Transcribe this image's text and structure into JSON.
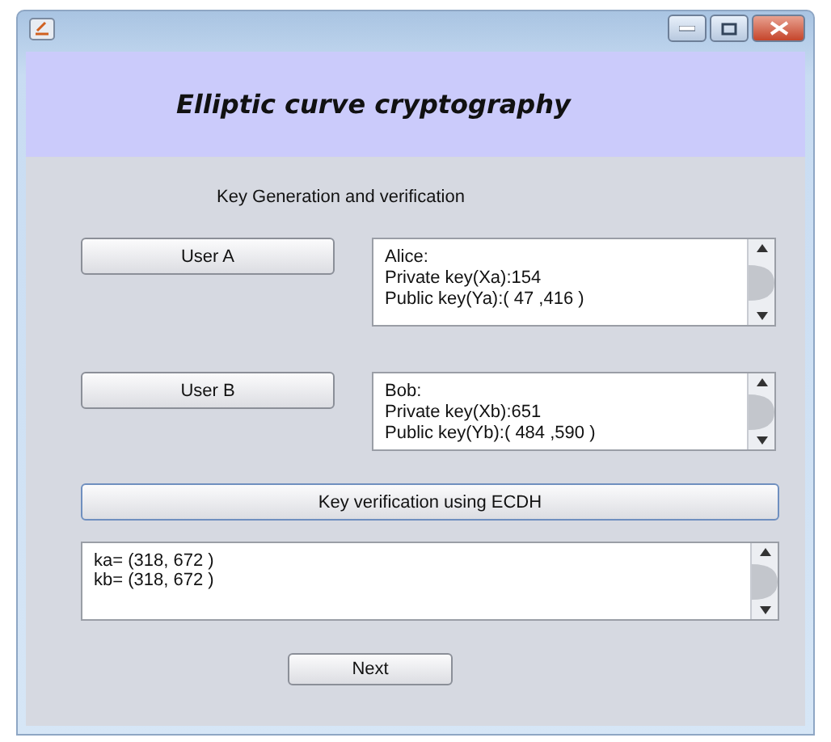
{
  "banner": {
    "title": "Elliptic curve cryptography"
  },
  "heading": "Key Generation and verification",
  "users": [
    {
      "button": "User A",
      "output": [
        "Alice:",
        "Private key(Xa):154",
        "Public key(Ya):( 47 ,416 )"
      ]
    },
    {
      "button": "User B",
      "output": [
        "Bob:",
        "Private key(Xb):651",
        "Public key(Yb):( 484 ,590 )"
      ]
    }
  ],
  "verify_button": "Key verification using ECDH",
  "result": [
    "ka= (318, 672 )",
    "kb= (318, 672 )"
  ],
  "next_button": "Next"
}
